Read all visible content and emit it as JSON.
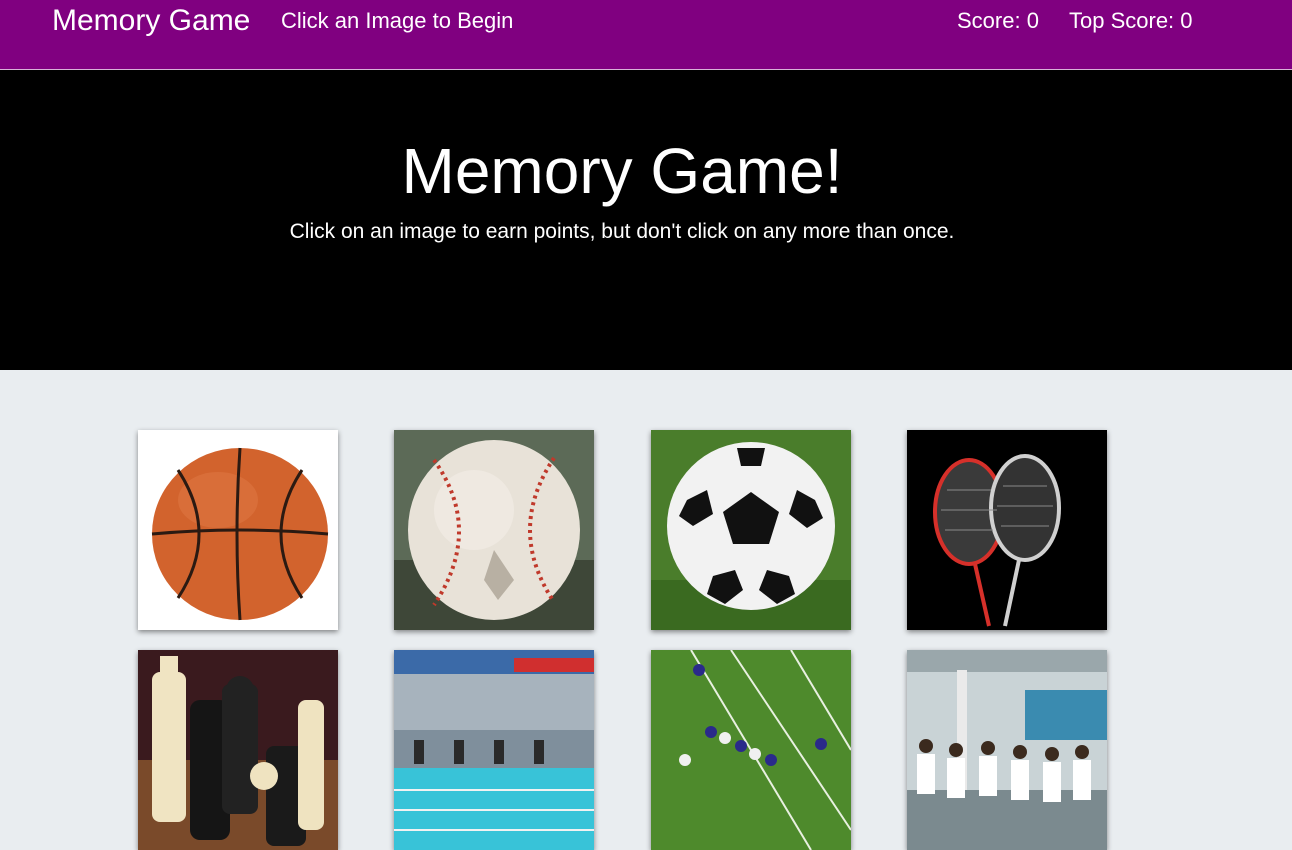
{
  "navbar": {
    "brand": "Memory Game",
    "message": "Click an Image to Begin",
    "score": "Score: 0",
    "top_score": "Top Score: 0"
  },
  "hero": {
    "title": "Memory Game!",
    "subtitle": "Click on an image to earn points, but don't click on any more than once."
  },
  "colors": {
    "navbar": "#800080",
    "hero": "#000000",
    "page_background": "#e9edf0"
  },
  "cards": [
    {
      "image": "basketball"
    },
    {
      "image": "baseball"
    },
    {
      "image": "soccer-ball"
    },
    {
      "image": "badminton-rackets"
    },
    {
      "image": "chess-pieces"
    },
    {
      "image": "swimming-pool"
    },
    {
      "image": "american-football-field"
    },
    {
      "image": "karate-class"
    }
  ]
}
